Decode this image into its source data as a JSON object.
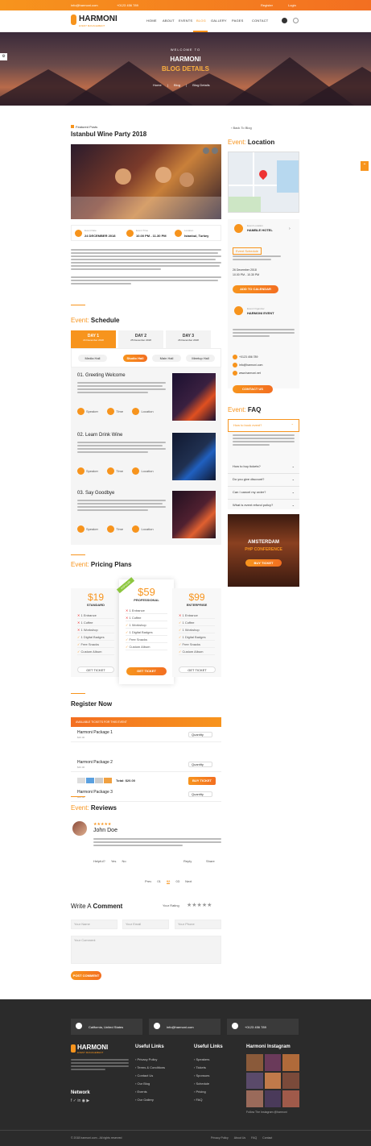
{
  "topbar": {
    "email": "info@harmoni.com",
    "phone": "+0123 456 789",
    "register": "Register",
    "login": "Login"
  },
  "brand": {
    "name": "HARMONI",
    "tagline": "EVENT MANAGEMENT",
    "accent": "#f7941d"
  },
  "nav": {
    "items": [
      "HOME",
      "ABOUT",
      "EVENTS",
      "BLOG",
      "GALLERY",
      "PAGES",
      "CONTACT"
    ],
    "active": "BLOG"
  },
  "hero": {
    "kicker": "WELCOME TO",
    "title": "HARMONI",
    "subtitle": "BLOG DETAILS",
    "crumbs": [
      "Home",
      "Blog",
      "Blog Details"
    ]
  },
  "post": {
    "category": "Featured Posts",
    "title": "Istanbul Wine Party 2018",
    "meta": [
      {
        "label": "Event Date",
        "value": "24 DECEMBER 2018"
      },
      {
        "label": "Event Time",
        "value": "10.00 PM - 11.30 PM"
      },
      {
        "label": "Location",
        "value": "Istanbul, Turkey"
      }
    ]
  },
  "schedule": {
    "title_o": "Event:",
    "title": "Schedule",
    "days": [
      {
        "label": "DAY 1",
        "date": "24 December 2018"
      },
      {
        "label": "DAY 2",
        "date": "25 December 2018"
      },
      {
        "label": "DAY 3",
        "date": "26 December 2018"
      }
    ],
    "halls": [
      "Media Hall",
      "Studio Hall",
      "Main Hall",
      "Meetup Hall"
    ],
    "items": [
      {
        "title": "01. Greeting Welcome"
      },
      {
        "title": "02. Learn Drink Wine"
      },
      {
        "title": "03. Say Goodbye"
      }
    ],
    "item_meta": [
      "Speaker",
      "Time",
      "Location"
    ]
  },
  "pricing": {
    "title_o": "Event:",
    "title": "Pricing Plans",
    "plans": [
      {
        "price": "$19",
        "name": "STANDARD",
        "btn": "GET TICKET"
      },
      {
        "price": "$59",
        "name": "PROFESSIONAL",
        "btn": "GET TICKET",
        "badge": "POPULAR"
      },
      {
        "price": "$99",
        "name": "ENTERPRISE",
        "btn": "GET TICKET"
      }
    ],
    "features": [
      "1 Entrance",
      "1 Coffee",
      "1 Workshop",
      "1 Digital Badges",
      "Free Snacks",
      "Custom Album"
    ]
  },
  "register": {
    "title": "Register Now",
    "header": "AVAILABLE TICKETS FOR THIS EVENT",
    "packages": [
      {
        "name": "Harmoni Package 1",
        "price": "$20.00"
      },
      {
        "name": "Harmoni Package 2",
        "price": "$40.00"
      },
      {
        "name": "Harmoni Package 3",
        "price": "$60.00"
      }
    ],
    "qty": "Quantity",
    "total": "Total: $20.00",
    "buy": "BUY TICKET"
  },
  "reviews": {
    "title_o": "Event:",
    "title": "Reviews",
    "name": "John Doe",
    "helpful": "Helpful?",
    "yes": "Yes",
    "no": "No",
    "reply": "Reply",
    "share": "Share",
    "pages": [
      "Prev",
      "01",
      "02",
      "03",
      "Next"
    ]
  },
  "comment": {
    "title_o": "Write A",
    "title": "Comment",
    "rating": "Your Rating",
    "name": "Your Name",
    "email": "Your Email",
    "phone": "Your Phone",
    "msg": "Your Comment",
    "btn": "POST COMMENT"
  },
  "sidebar": {
    "back": "Back To Blog",
    "loc_title_o": "Event:",
    "loc_title": "Location",
    "venue_label": "Event Location",
    "venue": "HAMBLE HOTEL",
    "date_badge": "Event Schedule",
    "date": "26 December 2018",
    "date2": "10.00 PM - 10.30 PM",
    "add": "ADD TO CALENDAR",
    "organizer_label": "Event Organizer",
    "organizer": "HARMONI EVENT",
    "contact": [
      "+0123 456 789",
      "info@harmoni.com",
      "www.harmoni.net"
    ],
    "organizer_btn": "CONTACT US",
    "faq_title_o": "Event:",
    "faq_title": "FAQ",
    "faqs": [
      "How to book event?",
      "How to buy tickets?",
      "Do you give discount?",
      "Can I cancel my order?",
      "What is event refund policy?"
    ],
    "banner_line1": "AMSTERDAM",
    "banner_line2": "PHP CONFERENCE",
    "banner_btn": "BUY TICKET"
  },
  "footer": {
    "contacts": [
      "California, United States",
      "info@harmoni.com",
      "+0123 456 789"
    ],
    "useful1": "Useful Links",
    "useful2": "Useful Links",
    "instagram": "Harmoni Instagram",
    "links1": [
      "Privacy Policy",
      "Terms & Conditions",
      "Contact Us",
      "Our Blog",
      "Events",
      "Our Gallery"
    ],
    "links2": [
      "Speakers",
      "Tickets",
      "Sponsors",
      "Schedule",
      "Pricing",
      "FAQ"
    ],
    "network": "Network",
    "follow": "Follow The Instagram @harmoni",
    "copyright": "© 2018 harmoni.com - All rights reserved",
    "bottom": [
      "Privacy Policy",
      "About Us",
      "FAQ",
      "Contact"
    ]
  }
}
